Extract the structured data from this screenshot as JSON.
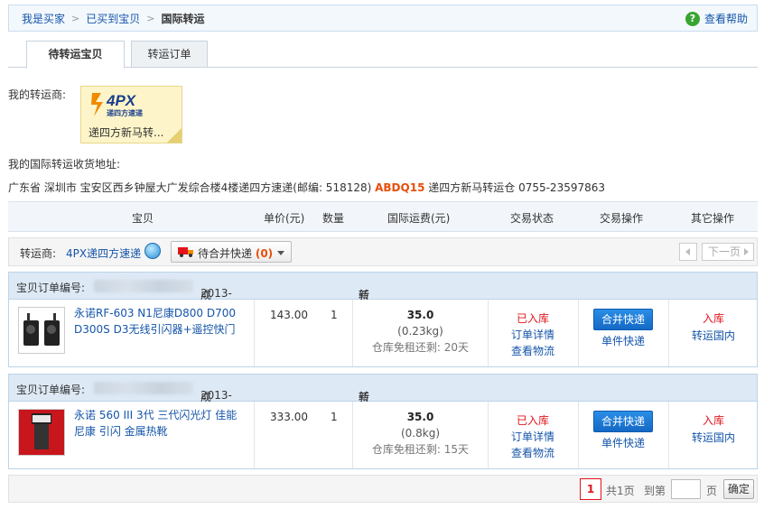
{
  "breadcrumb": {
    "items": [
      "我是买家",
      "已买到宝贝"
    ],
    "current": "国际转运",
    "help_label": "查看帮助"
  },
  "tabs": [
    "待转运宝贝",
    "转运订单"
  ],
  "carrier": {
    "label": "我的转运商:",
    "logo_text": "4PX",
    "logo_sub": "递四方速递",
    "card_name": "递四方新马转..."
  },
  "address": {
    "label": "我的国际转运收货地址:",
    "prefix": "广东省 深圳市 宝安区西乡钟屋大广发综合楼4楼递四方速递(邮编: 518128)",
    "code": "ABDQ15",
    "suffix": "递四方新马转运仓 0755-23597863"
  },
  "table_headers": [
    "宝贝",
    "单价(元)",
    "数量",
    "国际运费(元)",
    "交易状态",
    "交易操作",
    "其它操作"
  ],
  "toolbar": {
    "carrier_label": "转运商:",
    "carrier_link": "4PX递四方速递",
    "merge_label": "待合并快递",
    "merge_count": "(0)",
    "next_page": "下一页"
  },
  "orders": [
    {
      "order_no_label": "宝贝订单编号:",
      "time_label": "成交时间:",
      "time": "2013-11-15 19:35",
      "region_label": "转运地区:",
      "region": "新加坡",
      "title": "永诺RF-603 N1尼康D800 D700 D300S D3无线引闪器+遥控快门",
      "price": "143.00",
      "qty": "1",
      "fee": "35.0",
      "weight": "(0.23kg)",
      "free_storage": "仓库免租还剩: 20天",
      "status": "已入库",
      "status_links": [
        "订单详情",
        "查看物流"
      ],
      "op_button": "合并快递",
      "op_link": "单件快递",
      "other_status": "入库",
      "other_link": "转运国内"
    },
    {
      "order_no_label": "宝贝订单编号:",
      "time_label": "成交时间:",
      "time": "2013-11-15 19:35",
      "region_label": "转运地区:",
      "region": "新加坡",
      "title": "永诺 560 III 3代 三代闪光灯 佳能尼康 引闪 金属热靴",
      "price": "333.00",
      "qty": "1",
      "fee": "35.0",
      "weight": "(0.8kg)",
      "free_storage": "仓库免租还剩: 15天",
      "status": "已入库",
      "status_links": [
        "订单详情",
        "查看物流"
      ],
      "op_button": "合并快递",
      "op_link": "单件快递",
      "other_status": "入库",
      "other_link": "转运国内"
    }
  ],
  "pagination": {
    "current": "1",
    "total": "共1页",
    "goto": "到第",
    "unit": "页",
    "confirm": "确定"
  },
  "colors": {
    "link": "#1555a9",
    "status_red": "#e4141b",
    "code_orange": "#e4500b",
    "button_blue": "#1469c6",
    "header_bg": "#dde9f5"
  }
}
